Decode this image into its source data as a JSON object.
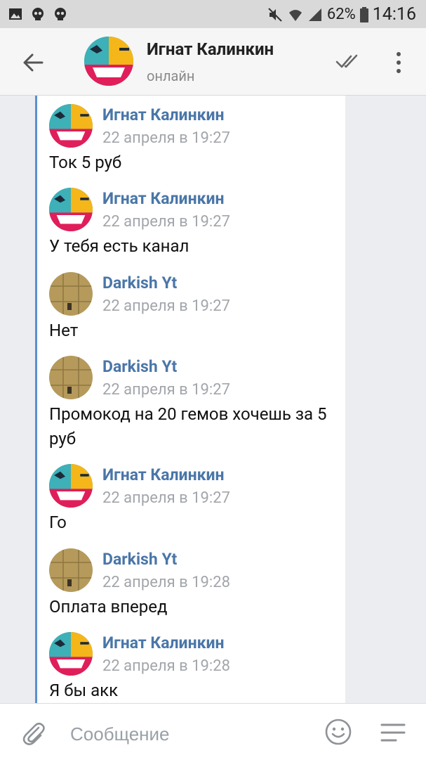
{
  "status_bar": {
    "battery": "62%",
    "time": "14:16"
  },
  "header": {
    "title": "Игнат Калинкин",
    "subtitle": "онлайн"
  },
  "messages": [
    {
      "author": "Игнат Калинкин",
      "date": "22 апреля в 19:27",
      "text": "Ток 5 руб",
      "avatar": "brawler-avatar"
    },
    {
      "author": "Игнат Калинкин",
      "date": "22 апреля в 19:27",
      "text": "У тебя есть канал",
      "avatar": "brawler-avatar"
    },
    {
      "author": "Darkish Yt",
      "date": "22 апреля в 19:27",
      "text": "Нет",
      "avatar": "sand-avatar"
    },
    {
      "author": "Darkish Yt",
      "date": "22 апреля в 19:27",
      "text": "Промокод на 20 гемов хочешь за 5 руб",
      "avatar": "sand-avatar"
    },
    {
      "author": "Игнат Калинкин",
      "date": "22 апреля в 19:27",
      "text": "Го",
      "avatar": "brawler-avatar"
    },
    {
      "author": "Darkish Yt",
      "date": "22 апреля в 19:28",
      "text": "Оплата вперед",
      "avatar": "sand-avatar"
    },
    {
      "author": "Игнат Калинкин",
      "date": "22 апреля в 19:28",
      "text": "Я бы акк",
      "avatar": "brawler-avatar"
    }
  ],
  "composer": {
    "placeholder": "Сообщение"
  }
}
